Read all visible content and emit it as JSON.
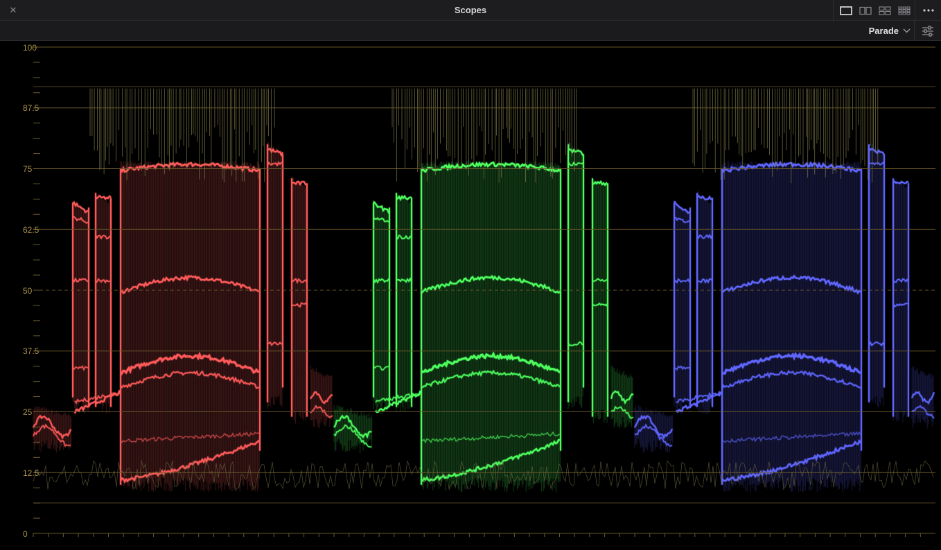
{
  "window": {
    "title": "Scopes",
    "close_icon": "close-icon"
  },
  "layout_buttons": [
    {
      "name": "single-view",
      "icon": "single-layout-icon",
      "active": true
    },
    {
      "name": "dual-view",
      "icon": "dual-layout-icon",
      "active": false
    },
    {
      "name": "quad-view",
      "icon": "quad-layout-icon",
      "active": false
    },
    {
      "name": "multi-view",
      "icon": "multi-layout-icon",
      "active": false
    }
  ],
  "toolbar": {
    "scope_type": "Parade",
    "options_icon": "chevron-down-icon",
    "settings_icon": "sliders-icon"
  },
  "scale": {
    "labels": [
      "100",
      "87.5",
      "75",
      "62.5",
      "50",
      "37.5",
      "25",
      "12.5",
      "0"
    ],
    "values": [
      100,
      87.5,
      75,
      62.5,
      50,
      37.5,
      25,
      12.5,
      0
    ],
    "dashed_value": 50
  },
  "colors": {
    "accent": "#b39b53",
    "grid": "#6c5c2c",
    "red": "#ff6b6b",
    "green": "#5dff6a",
    "blue": "#6f74ff"
  },
  "channels": [
    {
      "name": "red",
      "color": "#ff5a5a"
    },
    {
      "name": "green",
      "color": "#4dff5e"
    },
    {
      "name": "blue",
      "color": "#5f66ff"
    }
  ]
}
